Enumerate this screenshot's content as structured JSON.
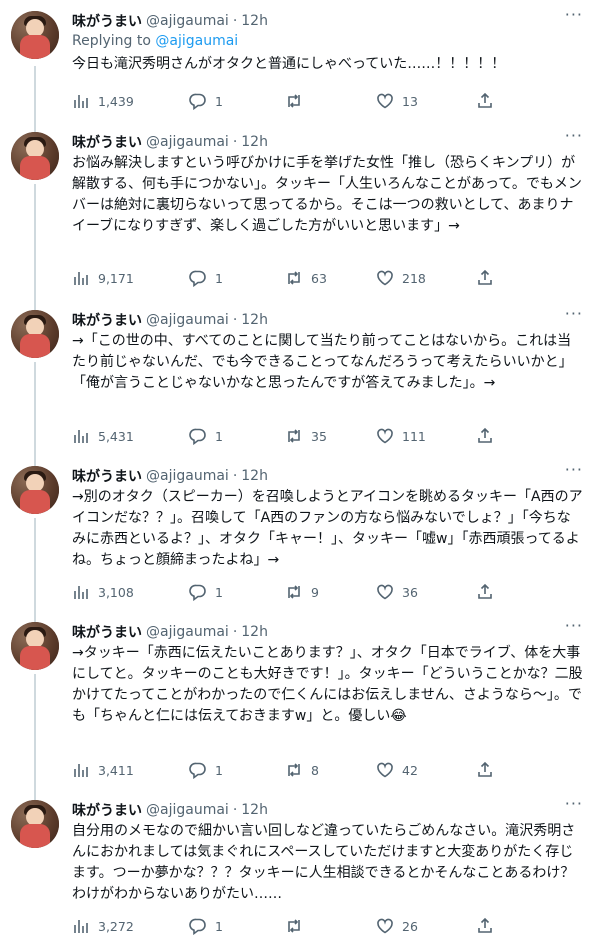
{
  "user": {
    "name": "味がうまい",
    "handle": "@ajigaumai",
    "time": "12h"
  },
  "reply_label": "Replying to",
  "reply_handle": "@ajigaumai",
  "tweets": [
    {
      "text": "今日も滝沢秀明さんがオタクと普通にしゃべっていた……！！！！！",
      "views": "1,439",
      "replies": "1",
      "retweets": "",
      "likes": "13"
    },
    {
      "text": "お悩み解決しますという呼びかけに手を挙げた女性「推し（恐らくキンプリ）が解散する、何も手につかない」。タッキー「人生いろんなことがあって。でもメンバーは絶対に裏切らないって思ってるから。そこは一つの救いとして、あまりナイーブになりすぎず、楽しく過ごした方がいいと思います」→",
      "views": "9,171",
      "replies": "1",
      "retweets": "63",
      "likes": "218"
    },
    {
      "text": "→「この世の中、すべてのことに関して当たり前ってことはないから。これは当たり前じゃないんだ、でも今できることってなんだろうって考えたらいいかと」「俺が言うことじゃないかなと思ったんですが答えてみました」。→",
      "views": "5,431",
      "replies": "1",
      "retweets": "35",
      "likes": "111"
    },
    {
      "text": "→別のオタク（スピーカー）を召喚しようとアイコンを眺めるタッキー「A西のアイコンだな？？」。召喚して「A西のファンの方なら悩みないでしょ？」「今ちなみに赤西といるよ？」、オタク「キャー！」、タッキー「嘘w」「赤西頑張ってるよね。ちょっと顔締まったよね」→",
      "views": "3,108",
      "replies": "1",
      "retweets": "9",
      "likes": "36"
    },
    {
      "text": "→タッキー「赤西に伝えたいことあります？」、オタク「日本でライブ、体を大事にしてと。タッキーのことも大好きです！」。タッキー「どういうことかな？二股かけてたってことがわかったので仁くんにはお伝えしません、さようなら〜」。でも「ちゃんと仁には伝えておきますw」と。優しい😂",
      "views": "3,411",
      "replies": "1",
      "retweets": "8",
      "likes": "42"
    },
    {
      "text": "自分用のメモなので細かい言い回しなど違っていたらごめんなさい。滝沢秀明さんにおかれましては気まぐれにスペースしていただけますと大変ありがたく存じます。つーか夢かな？？？タッキーに人生相談できるとかそんなことあるわけ？わけがわからないありがたい……",
      "views": "3,272",
      "replies": "1",
      "retweets": "",
      "likes": "26"
    }
  ]
}
